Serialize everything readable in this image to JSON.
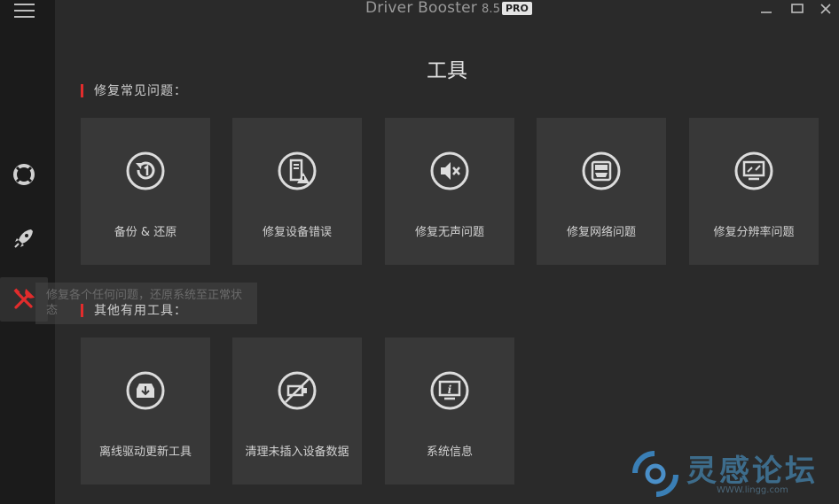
{
  "window": {
    "app_name": "Driver Booster",
    "version": "8.5",
    "badge": "PRO",
    "controls": [
      "minimize-icon",
      "maximize-icon",
      "close-icon"
    ]
  },
  "sidebar": {
    "menu_icon": "hamburger-icon",
    "items": [
      {
        "icon": "lifebuoy-icon",
        "active": false
      },
      {
        "icon": "rocket-icon",
        "active": false
      },
      {
        "icon": "tools-icon",
        "active": true
      }
    ]
  },
  "page": {
    "title": "工具"
  },
  "tooltip": {
    "text": "修复各个任何问题，还原系统至正常状态"
  },
  "sections": [
    {
      "title": "修复常见问题：",
      "tiles": [
        {
          "label": "备份 & 还原",
          "icon": "backup-restore-icon"
        },
        {
          "label": "修复设备错误",
          "icon": "device-error-icon"
        },
        {
          "label": "修复无声问题",
          "icon": "sound-mute-icon"
        },
        {
          "label": "修复网络问题",
          "icon": "network-icon"
        },
        {
          "label": "修复分辨率问题",
          "icon": "resolution-icon"
        }
      ]
    },
    {
      "title": "其他有用工具：",
      "tiles": [
        {
          "label": "离线驱动更新工具",
          "icon": "offline-update-icon"
        },
        {
          "label": "清理未插入设备数据",
          "icon": "clean-device-icon"
        },
        {
          "label": "系统信息",
          "icon": "system-info-icon"
        }
      ]
    }
  ],
  "watermark": {
    "text": "灵感论坛",
    "url": "WWW.lingg.com"
  },
  "colors": {
    "accent": "#e22c2c",
    "tile_bg": "#383838",
    "sidebar_bg": "#1b1b1b",
    "content_bg": "#2a2a2a"
  }
}
